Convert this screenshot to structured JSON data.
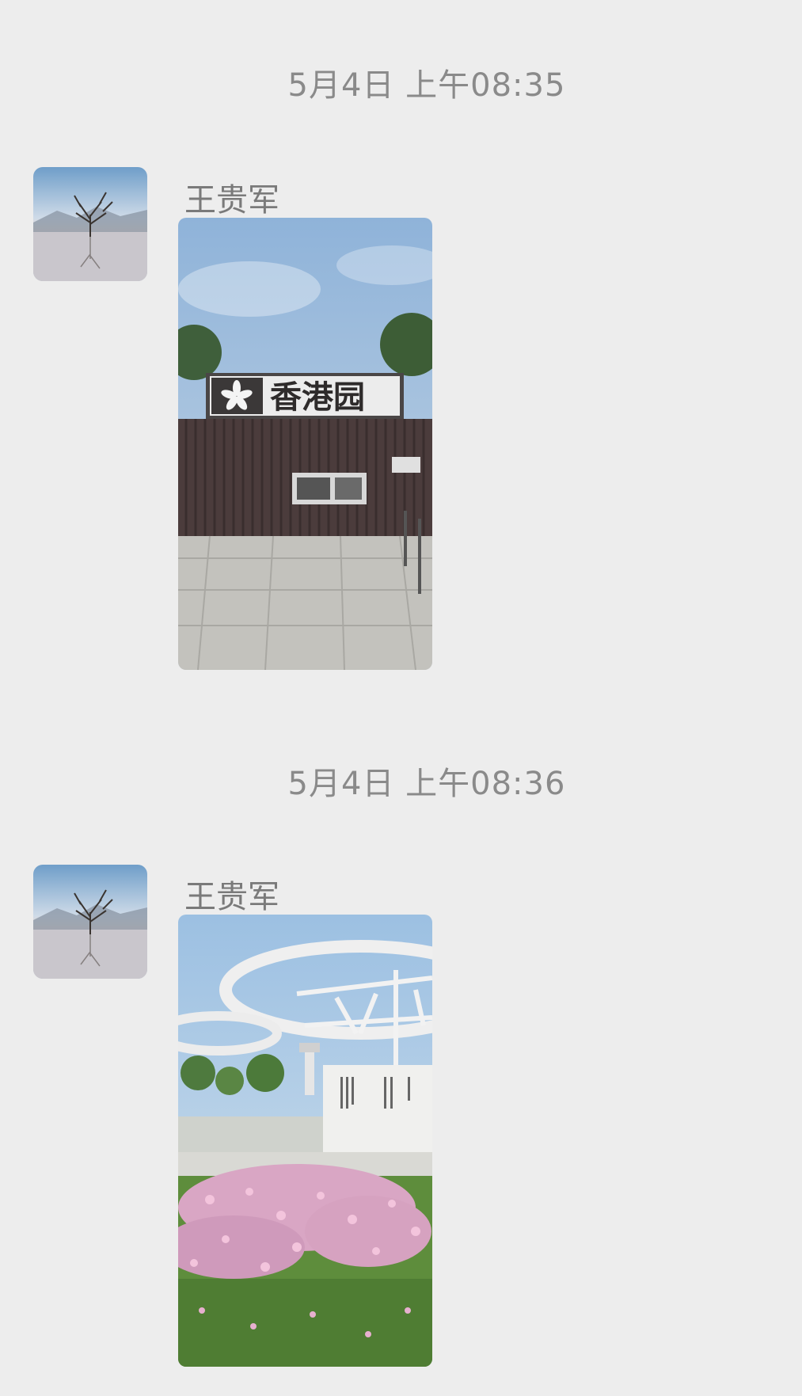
{
  "messages": [
    {
      "timestamp": "5月4日 上午08:35",
      "sender": "王贵军",
      "sign_text": "香港园"
    },
    {
      "timestamp": "5月4日 上午08:36",
      "sender": "王贵军"
    }
  ],
  "colors": {
    "background": "#ededed",
    "timestamp_text": "#8a8a8a",
    "sender_text": "#7a7a7a"
  },
  "icons": [
    "avatar-tree-lake-image"
  ]
}
